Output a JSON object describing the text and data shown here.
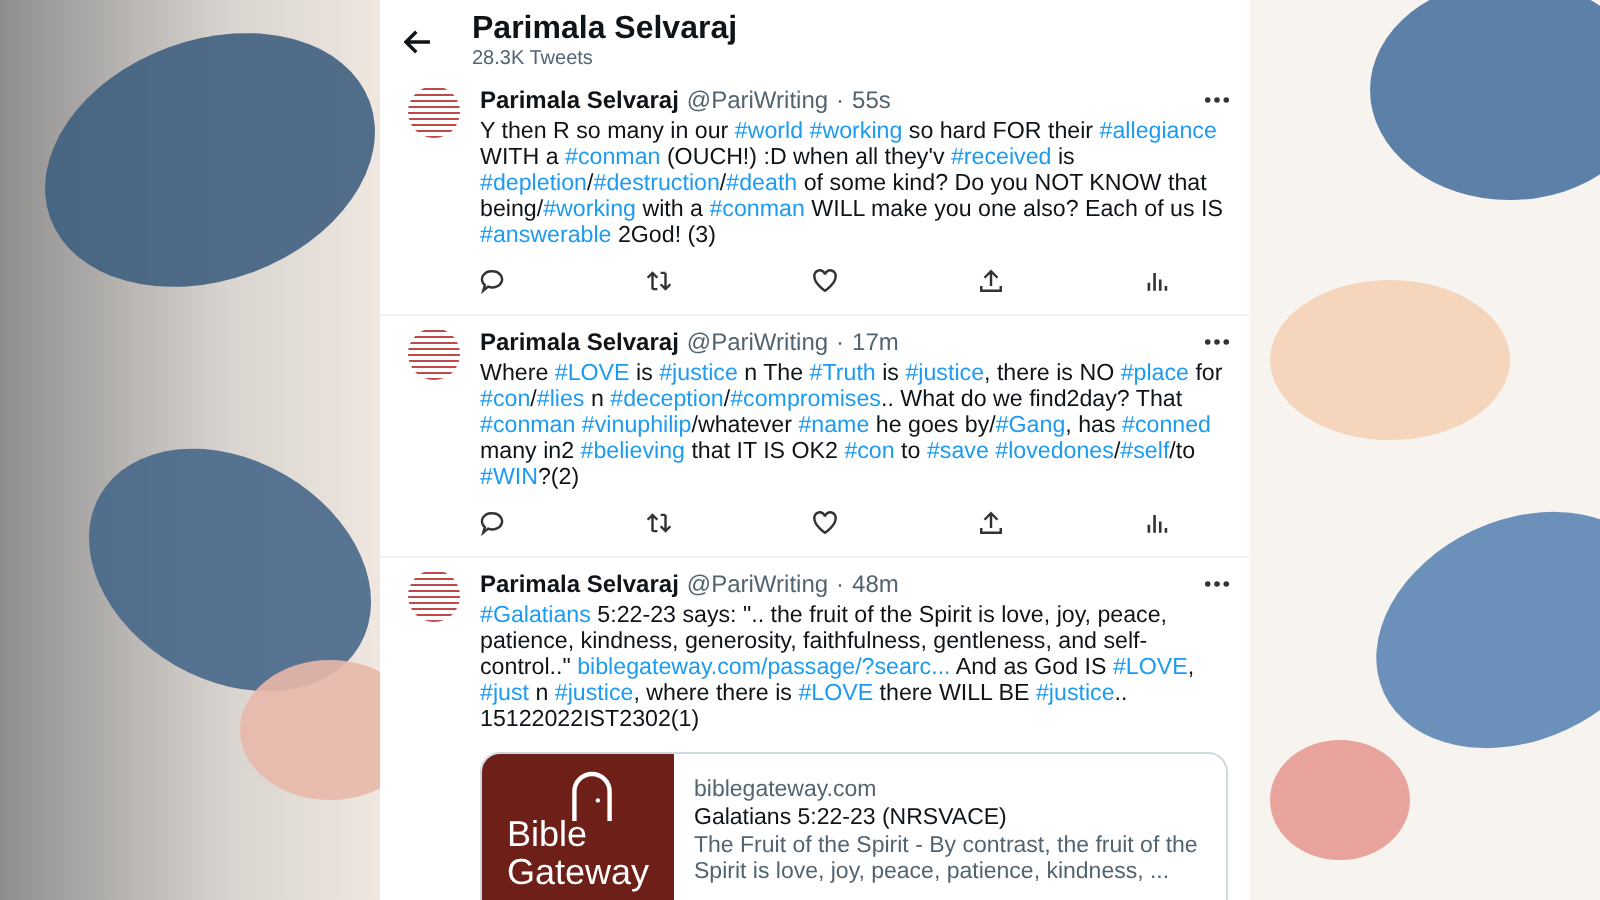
{
  "header": {
    "title": "Parimala Selvaraj",
    "subtitle": "28.3K Tweets"
  },
  "tweets": [
    {
      "name": "Parimala Selvaraj",
      "handle": "@PariWriting",
      "dot": "·",
      "time": "55s",
      "text": [
        {
          "kind": "plain",
          "text": "Y then R so many in our "
        },
        {
          "kind": "tag",
          "text": "#world "
        },
        {
          "kind": "tag",
          "text": "#working"
        },
        {
          "kind": "plain",
          "text": " so hard FOR their "
        },
        {
          "kind": "tag",
          "text": "#allegiance"
        },
        {
          "kind": "plain",
          "text": " WITH a "
        },
        {
          "kind": "tag",
          "text": "#conman"
        },
        {
          "kind": "plain",
          "text": " (OUCH!) :D when all they'v "
        },
        {
          "kind": "tag",
          "text": "#received"
        },
        {
          "kind": "plain",
          "text": " is "
        },
        {
          "kind": "tag",
          "text": "#depletion"
        },
        {
          "kind": "plain",
          "text": "/"
        },
        {
          "kind": "tag",
          "text": "#destruction"
        },
        {
          "kind": "plain",
          "text": "/"
        },
        {
          "kind": "tag",
          "text": "#death"
        },
        {
          "kind": "plain",
          "text": " of some kind? Do you NOT KNOW that being/"
        },
        {
          "kind": "tag",
          "text": "#working"
        },
        {
          "kind": "plain",
          "text": " with a "
        },
        {
          "kind": "tag",
          "text": "#conman"
        },
        {
          "kind": "plain",
          "text": " WILL make you one also? Each of us IS "
        },
        {
          "kind": "tag",
          "text": "#answerable"
        },
        {
          "kind": "plain",
          "text": " 2God! (3)"
        }
      ]
    },
    {
      "name": "Parimala Selvaraj",
      "handle": "@PariWriting",
      "dot": "·",
      "time": "17m",
      "text": [
        {
          "kind": "plain",
          "text": "Where "
        },
        {
          "kind": "tag",
          "text": "#LOVE"
        },
        {
          "kind": "plain",
          "text": " is "
        },
        {
          "kind": "tag",
          "text": "#justice"
        },
        {
          "kind": "plain",
          "text": " n The "
        },
        {
          "kind": "tag",
          "text": "#Truth"
        },
        {
          "kind": "plain",
          "text": " is "
        },
        {
          "kind": "tag",
          "text": "#justice"
        },
        {
          "kind": "plain",
          "text": ", there is NO "
        },
        {
          "kind": "tag",
          "text": "#place"
        },
        {
          "kind": "plain",
          "text": " for "
        },
        {
          "kind": "tag",
          "text": "#con"
        },
        {
          "kind": "plain",
          "text": "/"
        },
        {
          "kind": "tag",
          "text": "#lies"
        },
        {
          "kind": "plain",
          "text": " n "
        },
        {
          "kind": "tag",
          "text": "#deception"
        },
        {
          "kind": "plain",
          "text": "/"
        },
        {
          "kind": "tag",
          "text": "#compromises"
        },
        {
          "kind": "plain",
          "text": ".. What do we find2day? That "
        },
        {
          "kind": "tag",
          "text": "#conman "
        },
        {
          "kind": "tag",
          "text": "#vinuphilip"
        },
        {
          "kind": "plain",
          "text": "/whatever "
        },
        {
          "kind": "tag",
          "text": "#name"
        },
        {
          "kind": "plain",
          "text": " he goes by/"
        },
        {
          "kind": "tag",
          "text": "#Gang"
        },
        {
          "kind": "plain",
          "text": ", has "
        },
        {
          "kind": "tag",
          "text": "#conned"
        },
        {
          "kind": "plain",
          "text": " many in2 "
        },
        {
          "kind": "tag",
          "text": "#believing"
        },
        {
          "kind": "plain",
          "text": " that IT IS OK2 "
        },
        {
          "kind": "tag",
          "text": "#con"
        },
        {
          "kind": "plain",
          "text": " to "
        },
        {
          "kind": "tag",
          "text": "#save "
        },
        {
          "kind": "tag",
          "text": "#lovedones"
        },
        {
          "kind": "plain",
          "text": "/"
        },
        {
          "kind": "tag",
          "text": "#self"
        },
        {
          "kind": "plain",
          "text": "/to "
        },
        {
          "kind": "tag",
          "text": "#WIN"
        },
        {
          "kind": "plain",
          "text": "?(2)"
        }
      ]
    },
    {
      "name": "Parimala Selvaraj",
      "handle": "@PariWriting",
      "dot": "·",
      "time": "48m",
      "text": [
        {
          "kind": "tag",
          "text": "#Galatians"
        },
        {
          "kind": "plain",
          "text": " 5:22-23 says: \".. the fruit of the Spirit is love, joy, peace, patience, kindness, generosity, faithfulness, gentleness, and self-control..\" "
        },
        {
          "kind": "link",
          "text": "biblegateway.com/passage/?searc..."
        },
        {
          "kind": "plain",
          "text": " And as God IS "
        },
        {
          "kind": "tag",
          "text": "#LOVE"
        },
        {
          "kind": "plain",
          "text": ", "
        },
        {
          "kind": "tag",
          "text": "#just"
        },
        {
          "kind": "plain",
          "text": " n "
        },
        {
          "kind": "tag",
          "text": "#justice"
        },
        {
          "kind": "plain",
          "text": ", where there is "
        },
        {
          "kind": "tag",
          "text": "#LOVE"
        },
        {
          "kind": "plain",
          "text": " there WILL BE "
        },
        {
          "kind": "tag",
          "text": "#justice"
        },
        {
          "kind": "plain",
          "text": ".. 15122022IST2302(1)"
        }
      ],
      "card": {
        "logo_lines": [
          "Bible",
          "Gateway"
        ],
        "domain": "biblegateway.com",
        "title": "Galatians 5:22-23 (NRSVACE)",
        "description": "The Fruit of the Spirit - By contrast, the fruit of the Spirit is love, joy, peace, patience, kindness, ..."
      }
    }
  ]
}
